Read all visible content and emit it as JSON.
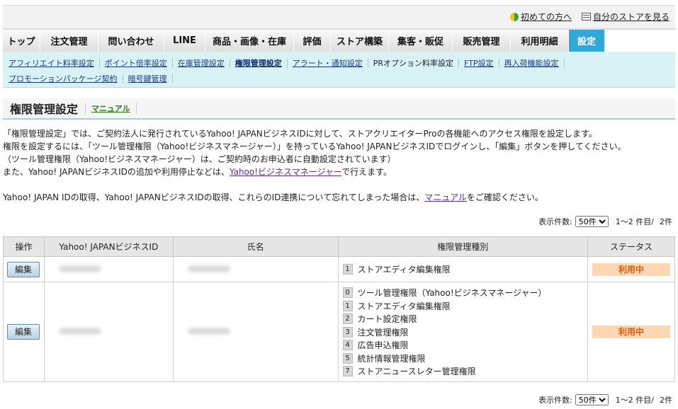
{
  "header": {
    "beginner_link": "初めての方へ",
    "view_store_link": "自分のストアを見る"
  },
  "nav": {
    "tabs": [
      "トップ",
      "注文管理",
      "問い合わせ",
      "LINE",
      "商品・画像・在庫",
      "評価",
      "ストア構築",
      "集客・販促",
      "販売管理",
      "利用明細",
      "設定"
    ],
    "active": "設定"
  },
  "subnav": {
    "row1": [
      "アフィリエイト料率設定",
      "ポイント倍率設定",
      "在庫管理設定",
      "権限管理設定",
      "アラート・通知設定",
      "PRオプション料率設定",
      "FTP設定",
      "再入荷機能設定"
    ],
    "row2": [
      "プロモーションパッケージ契約",
      "暗号鍵管理"
    ],
    "current": "権限管理設定"
  },
  "page": {
    "title": "権限管理設定",
    "manual_link": "マニュアル"
  },
  "intro": {
    "line1": "「権限管理設定」では、ご契約法人に発行されているYahoo! JAPANビジネスIDに対して、ストアクリエイターProの各機能へのアクセス権限を設定します。",
    "line2": "権限を設定するには、「ツール管理権限（Yahoo!ビジネスマネージャー）」を持っているYahoo! JAPANビジネスIDでログインし、「編集」ボタンを押してください。",
    "line3": "（ツール管理権限（Yahoo!ビジネスマネージャー）は、ご契約時のお申込者に自動設定されています）",
    "line4_pre": "また、Yahoo! JAPANビジネスIDの追加や利用停止などは、",
    "line4_link": "Yahoo!ビジネスマネージャー",
    "line4_post": "で行えます。",
    "line5_pre": "Yahoo! JAPAN IDの取得、Yahoo! JAPANビジネスIDの取得、これらのID連携について忘れてしまった場合は、",
    "line5_link": "マニュアル",
    "line5_post": "をご確認ください。"
  },
  "pager": {
    "label": "表示件数:",
    "per_page": "50件",
    "range": "1〜2 件目/",
    "total": "2件"
  },
  "table": {
    "headers": [
      "操作",
      "Yahoo! JAPANビジネスID",
      "氏名",
      "権限管理種別",
      "ステータス"
    ],
    "edit_label": "編集",
    "rows": [
      {
        "permissions": [
          {
            "num": "1",
            "label": "ストアエディタ編集権限"
          }
        ],
        "status": "利用中"
      },
      {
        "permissions": [
          {
            "num": "0",
            "label": "ツール管理権限（Yahoo!ビジネスマネージャー）"
          },
          {
            "num": "1",
            "label": "ストアエディタ編集権限"
          },
          {
            "num": "2",
            "label": "カート設定権限"
          },
          {
            "num": "3",
            "label": "注文管理権限"
          },
          {
            "num": "4",
            "label": "広告申込権限"
          },
          {
            "num": "5",
            "label": "統計情報管理権限"
          },
          {
            "num": "7",
            "label": "ストアニュースレター管理権限"
          }
        ],
        "status": "利用中"
      }
    ]
  }
}
